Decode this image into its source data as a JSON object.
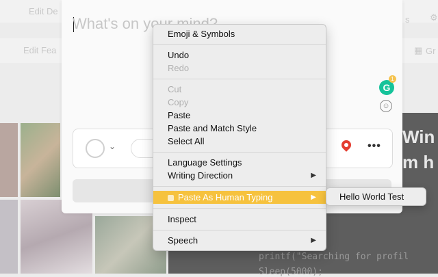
{
  "background": {
    "top_buttons": [
      "Edit De",
      "s"
    ],
    "second_bar": [
      "Edit Fea",
      "Gr"
    ],
    "dark_panel_text": [
      "Win",
      "m h"
    ],
    "code_lines": [
      "printf(\"Searching for profil",
      "Sleep(5000);"
    ]
  },
  "composer": {
    "placeholder": "What's on your mind?",
    "grammarly_letter": "G",
    "grammarly_badge": "1",
    "more_label": "•••"
  },
  "context_menu": {
    "emoji": "Emoji & Symbols",
    "undo": "Undo",
    "redo": "Redo",
    "cut": "Cut",
    "copy": "Copy",
    "paste": "Paste",
    "paste_match": "Paste and Match Style",
    "select_all": "Select All",
    "language_settings": "Language Settings",
    "writing_direction": "Writing Direction",
    "paste_human": "Paste As Human Typing",
    "inspect": "Inspect",
    "speech": "Speech",
    "submenu_arrow": "▶"
  },
  "submenu": {
    "item": "Hello World Test"
  },
  "colors": {
    "highlight": "#f6c23e",
    "grammarly": "#15c39a",
    "pin": "#e43d30"
  }
}
